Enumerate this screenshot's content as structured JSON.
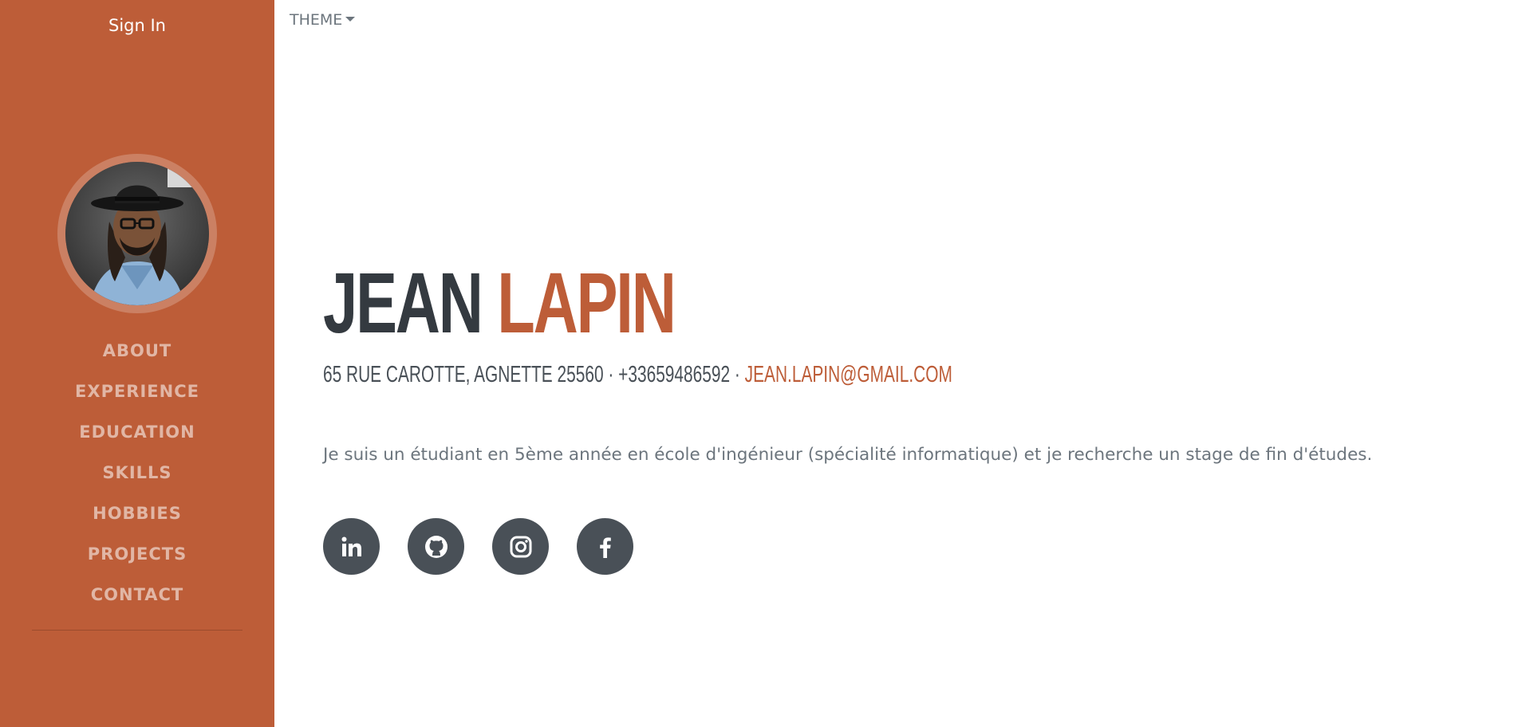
{
  "header": {
    "sign_in": "Sign In",
    "theme_label": "THEME"
  },
  "sidebar": {
    "items": [
      {
        "label": "ABOUT"
      },
      {
        "label": "EXPERIENCE"
      },
      {
        "label": "EDUCATION"
      },
      {
        "label": "SKILLS"
      },
      {
        "label": "HOBBIES"
      },
      {
        "label": "PROJECTS"
      },
      {
        "label": "CONTACT"
      }
    ]
  },
  "profile": {
    "first_name": "JEAN",
    "last_name": "LAPIN",
    "address": "65 RUE CAROTTE, AGNETTE 25560",
    "separator": " · ",
    "phone": "+33659486592",
    "email": "JEAN.LAPIN@GMAIL.COM",
    "bio": "Je suis un étudiant en 5ème année en école d'ingénieur (spécialité informatique) et je recherche un stage de fin d'études."
  },
  "socials": [
    {
      "icon": "linkedin-icon"
    },
    {
      "icon": "github-icon"
    },
    {
      "icon": "instagram-icon"
    },
    {
      "icon": "facebook-icon"
    }
  ],
  "colors": {
    "primary": "#bd5d38",
    "dark": "#343a40",
    "muted": "#6c757d",
    "social_bg": "#495057"
  }
}
